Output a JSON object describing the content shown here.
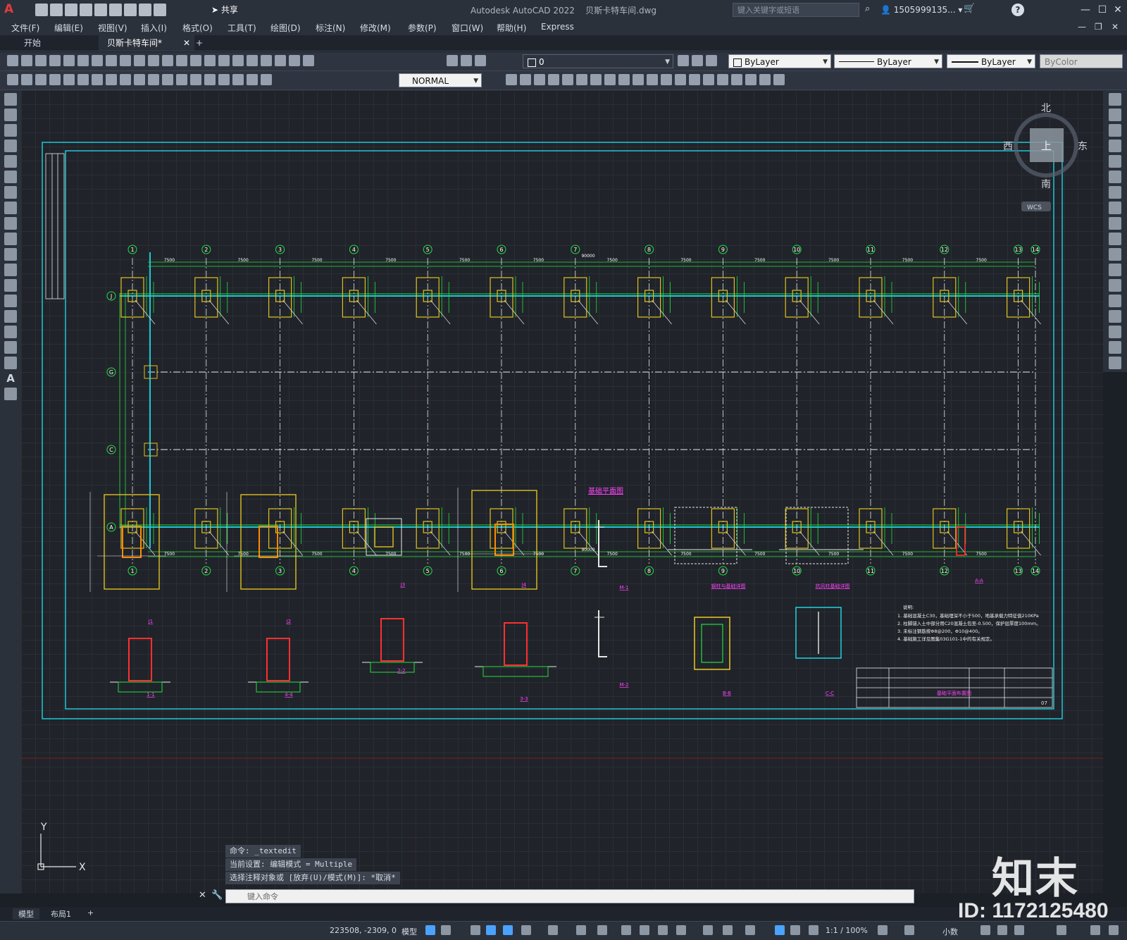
{
  "app": {
    "title": "Autodesk AutoCAD 2022",
    "file": "贝斯卡特车间.dwg",
    "share_label": "共享",
    "search_placeholder": "键入关键字或短语",
    "user": "1505999135...",
    "logo": "A"
  },
  "menu": [
    "文件(F)",
    "编辑(E)",
    "视图(V)",
    "插入(I)",
    "格式(O)",
    "工具(T)",
    "绘图(D)",
    "标注(N)",
    "修改(M)",
    "参数(P)",
    "窗口(W)",
    "帮助(H)",
    "Express"
  ],
  "tabs": {
    "start": "开始",
    "drawing": "贝斯卡特车间*",
    "add": "+"
  },
  "toolbar": {
    "layer": "0",
    "color": "ByLayer",
    "linetype": "ByLayer",
    "lineweight": "ByLayer",
    "plotstyle": "ByColor",
    "dimstyle": "NORMAL"
  },
  "viewcube": {
    "north": "北",
    "south": "南",
    "east": "东",
    "west": "西",
    "top": "上",
    "wcs": "WCS"
  },
  "ucs": {
    "x": "X",
    "y": "Y"
  },
  "drawing": {
    "grid_x": [
      "1",
      "2",
      "3",
      "4",
      "5",
      "6",
      "7",
      "8",
      "9",
      "10",
      "11",
      "12",
      "13",
      "14"
    ],
    "grid_y": [
      "J",
      "G",
      "C",
      "A"
    ],
    "span_dim": "7500",
    "total_dim": "90000",
    "plan_title": "基础平面图",
    "notes_title": "说明:",
    "notes": [
      "1. 基础混凝土C30，基础埋深不小于500，地基承载力特征值210KPa",
      "2. 柱脚锚入土中部分用C20混凝土包至-0.500，保护层厚度100mm。",
      "3. 未标注钢筋按Φ8@200，Φ10@400。",
      "4. 基础施工详见图集03G101-1中的有关规定。"
    ],
    "section_labels": [
      "J1",
      "J2",
      "J3",
      "J4",
      "1-1",
      "4-4",
      "2-2",
      "3-3",
      "M-1",
      "M-2",
      "B-B",
      "C-C",
      "A-A",
      "钢柱与基础详图",
      "抗风柱基础详图"
    ],
    "tb_title": "基础平面布置图",
    "tb_sheet": "07"
  },
  "command": {
    "history": [
      "命令: _textedit",
      "当前设置: 编辑模式 = Multiple",
      "选择注释对象或 [放弃(U)/模式(M)]: *取消*"
    ],
    "placeholder": "键入命令"
  },
  "layout_tabs": [
    "模型",
    "布局1",
    "+"
  ],
  "status": {
    "coords": "223508, -2309, 0",
    "model": "模型",
    "scale": "1:1 / 100%",
    "units": "小数"
  },
  "watermark": {
    "brand": "知末",
    "id": "ID: 1172125480"
  }
}
